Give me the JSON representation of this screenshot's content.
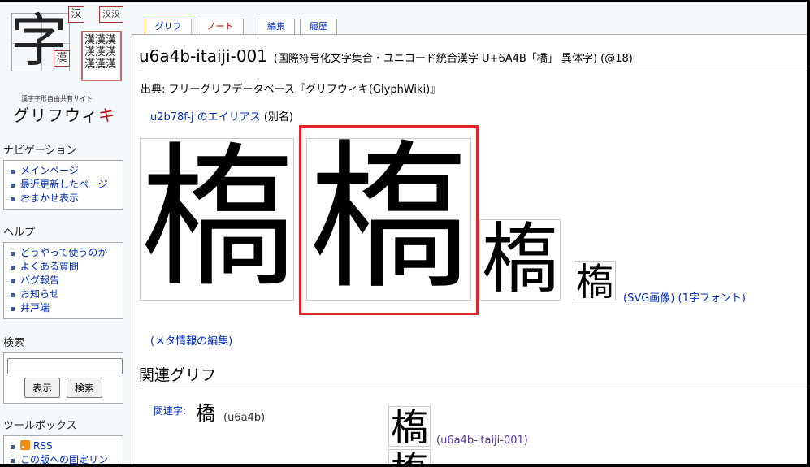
{
  "logo": {
    "big_char": "字",
    "stamps": [
      "汉",
      "漢",
      "汉汉"
    ],
    "block_chars": "漢漢漢漢漢漢漢漢漢",
    "tagline": "漢字字形自由共有サイト",
    "name_main": "グリフウィ",
    "name_accent": "キ"
  },
  "sidebar": {
    "navigation": {
      "title": "ナビゲーション",
      "items": [
        "メインページ",
        "最近更新したページ",
        "おまかせ表示"
      ]
    },
    "help": {
      "title": "ヘルプ",
      "items": [
        "どうやって使うのか",
        "よくある質問",
        "バグ報告",
        "お知らせ",
        "井戸端"
      ]
    },
    "search": {
      "title": "検索",
      "input_value": "",
      "go_label": "表示",
      "search_label": "検索"
    },
    "toolbox": {
      "title": "ツールボックス",
      "items": [
        "RSS",
        "この版への固定リン"
      ]
    }
  },
  "tabs": [
    {
      "label": "グリフ",
      "state": "selected"
    },
    {
      "label": "ノート",
      "state": "new"
    },
    {
      "label": "編集",
      "state": "normal"
    },
    {
      "label": "履歴",
      "state": "normal"
    }
  ],
  "page": {
    "title": "u6a4b-itaiji-001",
    "subtitle": "(国際符号化文字集合・ユニコード統合漢字 U+6A4B「橋」 異体字) (@18)",
    "source_label": "出典: フリーグリフデータベース『グリフウィキ(GlyphWiki)』",
    "alias_link": "u2b78f-j",
    "alias_link2": "のエイリアス",
    "alias_suffix": "(別名)",
    "glyph_char": "槗",
    "svg_link": "(SVG画像)",
    "font_link": "(1字フォント)",
    "meta_edit_link": "(メタ情報の編集)",
    "related_heading": "関連グリフ",
    "related_label": "関連字:",
    "related_char": "橋",
    "related_code": "(u6a4b)",
    "related_glyph_link": "(u6a4b-itaiji-001)"
  },
  "colors": {
    "link": "#002bb8",
    "visited": "#5a3696",
    "new_link": "#ba0000",
    "highlight": "#e0242b",
    "selected_tab_border": "#fabd23"
  }
}
